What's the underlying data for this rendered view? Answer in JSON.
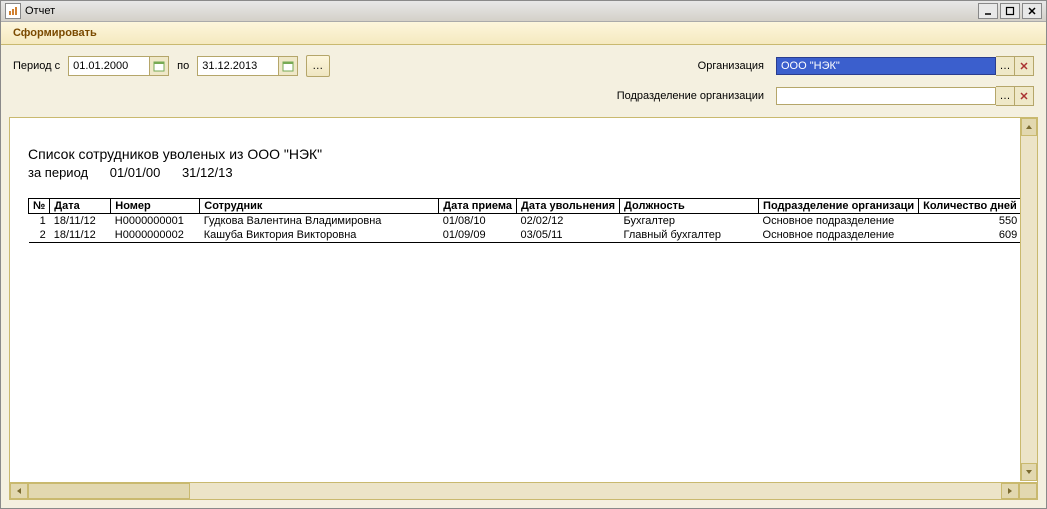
{
  "window": {
    "title": "Отчет"
  },
  "toolbar": {
    "generate": "Сформировать"
  },
  "filters": {
    "period_from_label": "Период с",
    "period_from": "01.01.2000",
    "period_to_label": "по",
    "period_to": "31.12.2013",
    "org_label": "Организация",
    "org_value": "ООО \"НЭК\"",
    "dept_label": "Подразделение организации",
    "dept_value": ""
  },
  "report": {
    "title": "Список сотрудников уволеных из ООО \"НЭК\"",
    "period_label": "за период",
    "period_from": "01/01/00",
    "period_to": "31/12/13",
    "columns": {
      "num": "№",
      "date": "Дата",
      "number": "Номер",
      "employee": "Сотрудник",
      "hire": "Дата приема",
      "fire": "Дата увольнения",
      "position": "Должность",
      "dept": "Подразделение организаци",
      "days": "Количество дней"
    },
    "rows": [
      {
        "num": "1",
        "date": "18/11/12",
        "number": "Н0000000001",
        "employee": "Гудкова Валентина Владимировна",
        "hire": "01/08/10",
        "fire": "02/02/12",
        "position": "Бухгалтер",
        "dept": "Основное подразделение",
        "days": "550"
      },
      {
        "num": "2",
        "date": "18/11/12",
        "number": "Н0000000002",
        "employee": "Кашуба Виктория Викторовна",
        "hire": "01/09/09",
        "fire": "03/05/11",
        "position": "Главный бухгалтер",
        "dept": "Основное подразделение",
        "days": "609"
      }
    ]
  }
}
